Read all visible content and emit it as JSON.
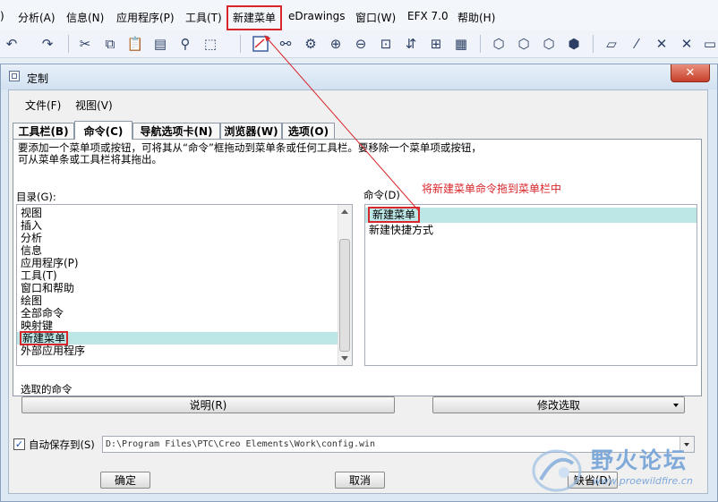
{
  "app_menu": {
    "items": [
      ")",
      "分析(A)",
      "信息(N)",
      "应用程序(P)",
      "工具(T)",
      "新建菜单",
      "eDrawings",
      "窗口(W)",
      "EFX 7.0",
      "帮助(H)"
    ]
  },
  "dialog": {
    "title": "定制",
    "close_label": "✕",
    "menu": {
      "file": "文件(F)",
      "view": "视图(V)"
    },
    "tabs": [
      "工具栏(B)",
      "命令(C)",
      "导航选项卡(N)",
      "浏览器(W)",
      "选项(O)"
    ],
    "instructions": "要添加一个菜单项或按钮，可将其从“命令”框拖动到菜单条或任何工具栏。要移除一个菜单项或按钮，\n可从菜单条或工具栏将其拖出。",
    "catalog_label": "目录(G):",
    "catalog_items": [
      "视图",
      "插入",
      "分析",
      "信息",
      "应用程序(P)",
      "工具(T)",
      "窗口和帮助",
      "绘图",
      "全部命令",
      "映射键",
      "新建菜单",
      "外部应用程序"
    ],
    "commands_label": "命令(D)",
    "annotation": "将新建菜单命令拖到菜单栏中",
    "command_items": [
      "新建菜单",
      "新建快捷方式"
    ],
    "selected_command_label": "选取的命令",
    "description_button": "说明(R)",
    "modify_selection": "修改选取",
    "autosave_label": "自动保存到(S)",
    "autosave_checked": true,
    "autosave_path": "D:\\Program Files\\PTC\\Creo Elements\\Work\\config.win",
    "ok_button": "确定",
    "cancel_button": "取消",
    "default_button": "缺省(D)"
  },
  "watermark": {
    "text": "野火论坛",
    "url": "www.proewildfire.cn"
  },
  "colors": {
    "highlight_red": "#d8262b",
    "selection": "#bde6e6",
    "dialog_bg": "#dce8f4"
  }
}
